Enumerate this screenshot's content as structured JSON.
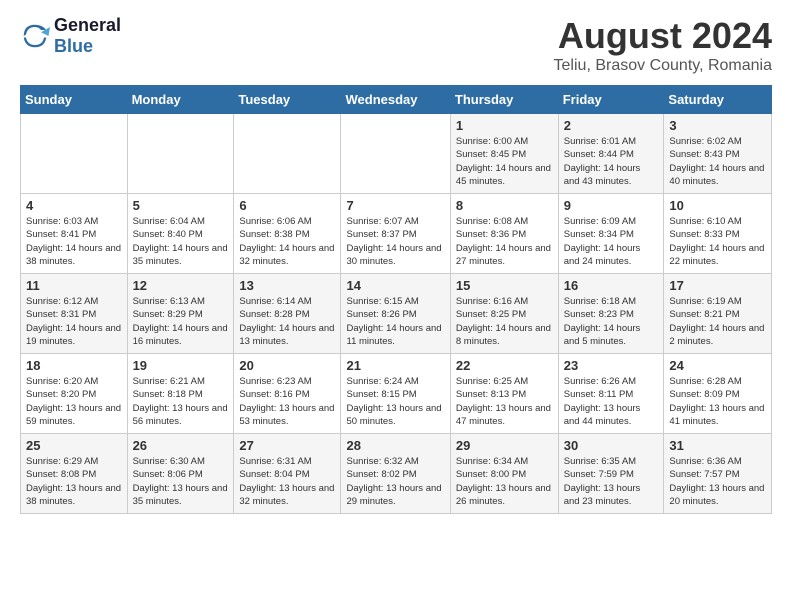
{
  "header": {
    "logo": {
      "general": "General",
      "blue": "Blue"
    },
    "title": "August 2024",
    "subtitle": "Teliu, Brasov County, Romania"
  },
  "calendar": {
    "headers": [
      "Sunday",
      "Monday",
      "Tuesday",
      "Wednesday",
      "Thursday",
      "Friday",
      "Saturday"
    ],
    "weeks": [
      [
        {
          "day": "",
          "info": ""
        },
        {
          "day": "",
          "info": ""
        },
        {
          "day": "",
          "info": ""
        },
        {
          "day": "",
          "info": ""
        },
        {
          "day": "1",
          "info": "Sunrise: 6:00 AM\nSunset: 8:45 PM\nDaylight: 14 hours and 45 minutes."
        },
        {
          "day": "2",
          "info": "Sunrise: 6:01 AM\nSunset: 8:44 PM\nDaylight: 14 hours and 43 minutes."
        },
        {
          "day": "3",
          "info": "Sunrise: 6:02 AM\nSunset: 8:43 PM\nDaylight: 14 hours and 40 minutes."
        }
      ],
      [
        {
          "day": "4",
          "info": "Sunrise: 6:03 AM\nSunset: 8:41 PM\nDaylight: 14 hours and 38 minutes."
        },
        {
          "day": "5",
          "info": "Sunrise: 6:04 AM\nSunset: 8:40 PM\nDaylight: 14 hours and 35 minutes."
        },
        {
          "day": "6",
          "info": "Sunrise: 6:06 AM\nSunset: 8:38 PM\nDaylight: 14 hours and 32 minutes."
        },
        {
          "day": "7",
          "info": "Sunrise: 6:07 AM\nSunset: 8:37 PM\nDaylight: 14 hours and 30 minutes."
        },
        {
          "day": "8",
          "info": "Sunrise: 6:08 AM\nSunset: 8:36 PM\nDaylight: 14 hours and 27 minutes."
        },
        {
          "day": "9",
          "info": "Sunrise: 6:09 AM\nSunset: 8:34 PM\nDaylight: 14 hours and 24 minutes."
        },
        {
          "day": "10",
          "info": "Sunrise: 6:10 AM\nSunset: 8:33 PM\nDaylight: 14 hours and 22 minutes."
        }
      ],
      [
        {
          "day": "11",
          "info": "Sunrise: 6:12 AM\nSunset: 8:31 PM\nDaylight: 14 hours and 19 minutes."
        },
        {
          "day": "12",
          "info": "Sunrise: 6:13 AM\nSunset: 8:29 PM\nDaylight: 14 hours and 16 minutes."
        },
        {
          "day": "13",
          "info": "Sunrise: 6:14 AM\nSunset: 8:28 PM\nDaylight: 14 hours and 13 minutes."
        },
        {
          "day": "14",
          "info": "Sunrise: 6:15 AM\nSunset: 8:26 PM\nDaylight: 14 hours and 11 minutes."
        },
        {
          "day": "15",
          "info": "Sunrise: 6:16 AM\nSunset: 8:25 PM\nDaylight: 14 hours and 8 minutes."
        },
        {
          "day": "16",
          "info": "Sunrise: 6:18 AM\nSunset: 8:23 PM\nDaylight: 14 hours and 5 minutes."
        },
        {
          "day": "17",
          "info": "Sunrise: 6:19 AM\nSunset: 8:21 PM\nDaylight: 14 hours and 2 minutes."
        }
      ],
      [
        {
          "day": "18",
          "info": "Sunrise: 6:20 AM\nSunset: 8:20 PM\nDaylight: 13 hours and 59 minutes."
        },
        {
          "day": "19",
          "info": "Sunrise: 6:21 AM\nSunset: 8:18 PM\nDaylight: 13 hours and 56 minutes."
        },
        {
          "day": "20",
          "info": "Sunrise: 6:23 AM\nSunset: 8:16 PM\nDaylight: 13 hours and 53 minutes."
        },
        {
          "day": "21",
          "info": "Sunrise: 6:24 AM\nSunset: 8:15 PM\nDaylight: 13 hours and 50 minutes."
        },
        {
          "day": "22",
          "info": "Sunrise: 6:25 AM\nSunset: 8:13 PM\nDaylight: 13 hours and 47 minutes."
        },
        {
          "day": "23",
          "info": "Sunrise: 6:26 AM\nSunset: 8:11 PM\nDaylight: 13 hours and 44 minutes."
        },
        {
          "day": "24",
          "info": "Sunrise: 6:28 AM\nSunset: 8:09 PM\nDaylight: 13 hours and 41 minutes."
        }
      ],
      [
        {
          "day": "25",
          "info": "Sunrise: 6:29 AM\nSunset: 8:08 PM\nDaylight: 13 hours and 38 minutes."
        },
        {
          "day": "26",
          "info": "Sunrise: 6:30 AM\nSunset: 8:06 PM\nDaylight: 13 hours and 35 minutes."
        },
        {
          "day": "27",
          "info": "Sunrise: 6:31 AM\nSunset: 8:04 PM\nDaylight: 13 hours and 32 minutes."
        },
        {
          "day": "28",
          "info": "Sunrise: 6:32 AM\nSunset: 8:02 PM\nDaylight: 13 hours and 29 minutes."
        },
        {
          "day": "29",
          "info": "Sunrise: 6:34 AM\nSunset: 8:00 PM\nDaylight: 13 hours and 26 minutes."
        },
        {
          "day": "30",
          "info": "Sunrise: 6:35 AM\nSunset: 7:59 PM\nDaylight: 13 hours and 23 minutes."
        },
        {
          "day": "31",
          "info": "Sunrise: 6:36 AM\nSunset: 7:57 PM\nDaylight: 13 hours and 20 minutes."
        }
      ]
    ]
  }
}
